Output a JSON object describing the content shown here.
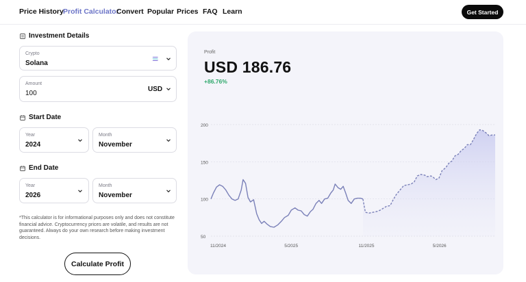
{
  "nav": {
    "items": [
      {
        "label": "Price History",
        "active": false
      },
      {
        "label": "Profit Calculator",
        "active": true
      },
      {
        "label": "Convert",
        "active": false
      },
      {
        "label": "Popular",
        "active": false
      },
      {
        "label": "Prices",
        "active": false
      },
      {
        "label": "FAQ",
        "active": false
      },
      {
        "label": "Learn",
        "active": false
      }
    ],
    "cta_label": "Get Started"
  },
  "investment": {
    "title": "Investment Details",
    "crypto": {
      "label": "Crypto",
      "value": "Solana",
      "icon": "solana-icon"
    },
    "amount": {
      "label": "Amount",
      "value": "100",
      "currency": "USD"
    }
  },
  "start_date": {
    "title": "Start Date",
    "year": {
      "label": "Year",
      "value": "2024"
    },
    "month": {
      "label": "Month",
      "value": "November"
    }
  },
  "end_date": {
    "title": "End Date",
    "year": {
      "label": "Year",
      "value": "2026"
    },
    "month": {
      "label": "Month",
      "value": "November"
    }
  },
  "disclaimer": "*This calculator is for informational purposes only and does not constitute financial advice. Cryptocurrency prices are volatile, and results are not guaranteed. Always do your own research before making investment decisions.",
  "calculate_label": "Calculate Profit",
  "result": {
    "label": "Profit",
    "value": "USD 186.76",
    "percent": "+86.76%"
  },
  "colors": {
    "accent": "#6b74c7",
    "line": "#7a80b8",
    "positive": "#2ea86b",
    "card_bg": "#f4f4fa"
  },
  "chart_data": {
    "type": "line",
    "xlabel": "",
    "ylabel": "",
    "ylim": [
      50,
      200
    ],
    "yticks": [
      50,
      100,
      150,
      200
    ],
    "xticks": [
      {
        "label": "11/2024",
        "t": 0
      },
      {
        "label": "5/2025",
        "t": 6
      },
      {
        "label": "11/2025",
        "t": 12
      },
      {
        "label": "5/2026",
        "t": 18
      }
    ],
    "grid": true,
    "series": [
      {
        "style": "solid",
        "points": [
          [
            0,
            100
          ],
          [
            0.2,
            108
          ],
          [
            0.45,
            116
          ],
          [
            0.7,
            119
          ],
          [
            0.95,
            117
          ],
          [
            1.2,
            112
          ],
          [
            1.45,
            105
          ],
          [
            1.7,
            100
          ],
          [
            1.95,
            98
          ],
          [
            2.2,
            100
          ],
          [
            2.45,
            112
          ],
          [
            2.6,
            126
          ],
          [
            2.8,
            121
          ],
          [
            3.0,
            102
          ],
          [
            3.2,
            96
          ],
          [
            3.45,
            99
          ],
          [
            3.7,
            80
          ],
          [
            3.9,
            72
          ],
          [
            4.1,
            67
          ],
          [
            4.3,
            70
          ],
          [
            4.55,
            66
          ],
          [
            4.8,
            63
          ],
          [
            5.1,
            62
          ],
          [
            5.4,
            65
          ],
          [
            5.7,
            70
          ],
          [
            5.95,
            75
          ],
          [
            6.25,
            78
          ],
          [
            6.5,
            85
          ],
          [
            6.8,
            88
          ],
          [
            7.05,
            85
          ],
          [
            7.3,
            84
          ],
          [
            7.55,
            79
          ],
          [
            7.8,
            77
          ],
          [
            8.05,
            83
          ],
          [
            8.25,
            86
          ],
          [
            8.5,
            94
          ],
          [
            8.75,
            98
          ],
          [
            8.95,
            94
          ],
          [
            9.2,
            100
          ],
          [
            9.45,
            101
          ],
          [
            9.7,
            108
          ],
          [
            9.9,
            112
          ],
          [
            10.05,
            120
          ],
          [
            10.3,
            115
          ],
          [
            10.5,
            113
          ],
          [
            10.7,
            117
          ],
          [
            10.9,
            108
          ],
          [
            11.1,
            98
          ],
          [
            11.35,
            94
          ],
          [
            11.6,
            100
          ],
          [
            11.85,
            101
          ],
          [
            12.1,
            101
          ],
          [
            12.3,
            100
          ]
        ]
      },
      {
        "style": "dashed",
        "points": [
          [
            12.3,
            100
          ],
          [
            12.5,
            82
          ],
          [
            12.8,
            81
          ],
          [
            13.1,
            82
          ],
          [
            13.4,
            83
          ],
          [
            13.7,
            85
          ],
          [
            14.0,
            88
          ],
          [
            14.2,
            90
          ],
          [
            14.5,
            91
          ],
          [
            14.75,
            99
          ],
          [
            15.0,
            106
          ],
          [
            15.3,
            112
          ],
          [
            15.6,
            118
          ],
          [
            15.9,
            119
          ],
          [
            16.2,
            120
          ],
          [
            16.45,
            123
          ],
          [
            16.7,
            131
          ],
          [
            17.0,
            133
          ],
          [
            17.3,
            132
          ],
          [
            17.5,
            130
          ],
          [
            17.8,
            131
          ],
          [
            18.0,
            129
          ],
          [
            18.2,
            126
          ],
          [
            18.45,
            128
          ],
          [
            18.7,
            138
          ],
          [
            19.0,
            142
          ],
          [
            19.25,
            148
          ],
          [
            19.5,
            151
          ],
          [
            19.75,
            158
          ],
          [
            20.0,
            160
          ],
          [
            20.25,
            165
          ],
          [
            20.5,
            168
          ],
          [
            20.75,
            173
          ],
          [
            21.0,
            173
          ],
          [
            21.25,
            180
          ],
          [
            21.5,
            188
          ],
          [
            21.75,
            193
          ],
          [
            22.0,
            192
          ],
          [
            22.25,
            189
          ],
          [
            22.5,
            185
          ],
          [
            22.75,
            186
          ],
          [
            23.0,
            186
          ]
        ]
      }
    ]
  }
}
